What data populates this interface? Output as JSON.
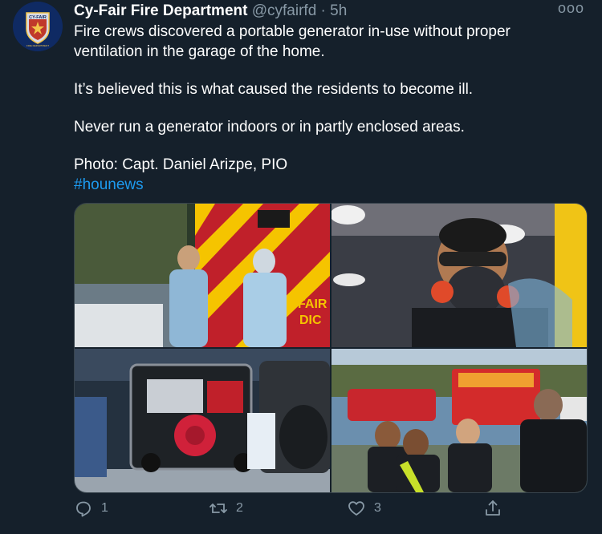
{
  "tweet": {
    "author_name": "Cy-Fair Fire Department",
    "handle": "@cyfairfd",
    "separator": "·",
    "time": "5h",
    "avatar_text_top": "CY-FAIR",
    "avatar_text_bottom": "FIRE DEPARTMENT",
    "paragraphs": [
      "Fire crews discovered a portable generator in-use without proper ventilation in the garage of the home.",
      "It’s believed this is what caused the residents to become ill.",
      "Never run a generator indoors or in partly enclosed areas.",
      "Photo: Capt. Daniel Arizpe, PIO"
    ],
    "hashtag": "#hounews",
    "more_label": "ooo"
  },
  "actions": {
    "reply_count": "1",
    "retweet_count": "2",
    "like_count": "3"
  },
  "media": {
    "photos": [
      {
        "label": "photo-ambulance-crew"
      },
      {
        "label": "photo-firefighter-respirator"
      },
      {
        "label": "photo-portable-generator"
      },
      {
        "label": "photo-fire-crew-outdoors"
      }
    ],
    "truck_text_1": "FAIR",
    "truck_text_2": "DIC"
  },
  "colors": {
    "background": "#15202b",
    "secondary_text": "#8899a6",
    "link": "#1d9bf0",
    "border": "#38444d"
  }
}
